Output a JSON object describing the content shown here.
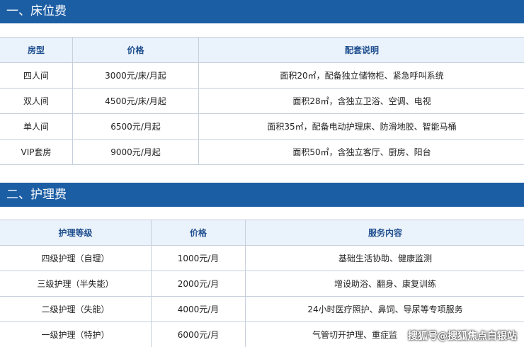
{
  "section1": {
    "title": "一、床位费",
    "headers": [
      "房型",
      "价格",
      "配套说明"
    ],
    "rows": [
      [
        "四人间",
        "3000元/床/月起",
        "面积20㎡，配备独立储物柜、紧急呼叫系统"
      ],
      [
        "双人间",
        "4500元/床/月起",
        "面积28㎡，含独立卫浴、空调、电视"
      ],
      [
        "单人间",
        "6500元/月起",
        "面积35㎡，配备电动护理床、防滑地胶、智能马桶"
      ],
      [
        "VIP套房",
        "9000元/月起",
        "面积50㎡，含独立客厅、厨房、阳台"
      ]
    ]
  },
  "section2": {
    "title": "二、护理费",
    "headers": [
      "护理等级",
      "价格",
      "服务内容"
    ],
    "rows": [
      [
        "四级护理（自理）",
        "1000元/月",
        "基础生活协助、健康监测"
      ],
      [
        "三级护理（半失能）",
        "2000元/月",
        "增设助浴、翻身、康复训练"
      ],
      [
        "二级护理（失能）",
        "4000元/月",
        "24小时医疗照护、鼻饲、导尿等专项服务"
      ],
      [
        "一级护理（特护）",
        "6000元/月",
        "气管切开护理、重症监"
      ]
    ]
  },
  "watermark": "搜狐号@搜狐焦点白银站"
}
